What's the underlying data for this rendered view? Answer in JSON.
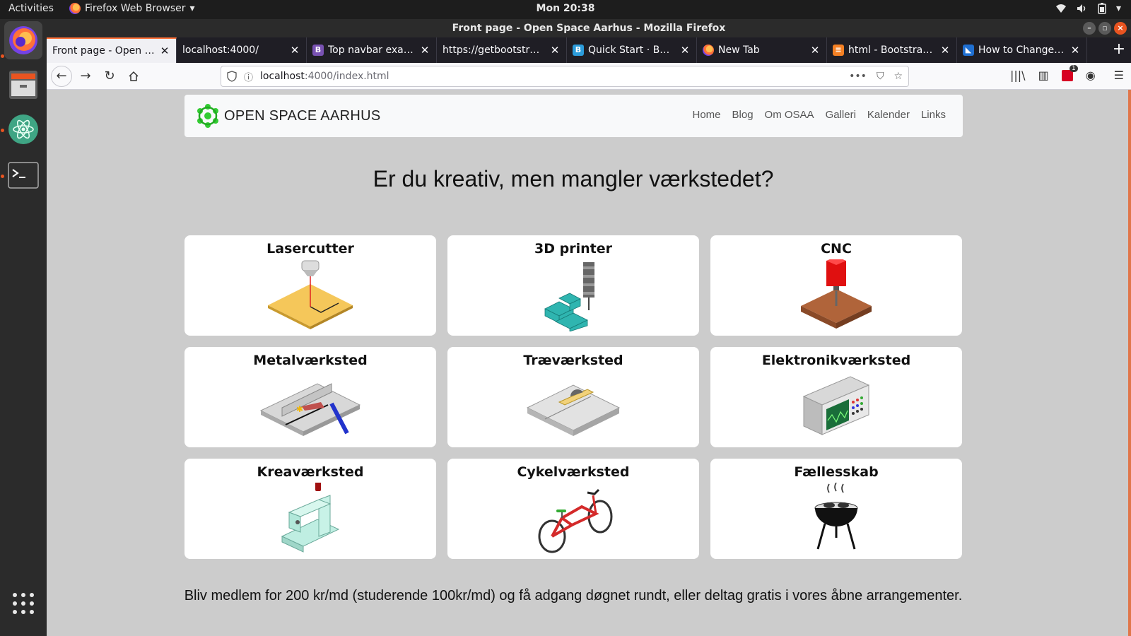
{
  "topbar": {
    "activities": "Activities",
    "app_menu": "Firefox Web Browser",
    "clock": "Mon 20:38"
  },
  "window": {
    "title": "Front page - Open Space Aarhus - Mozilla Firefox"
  },
  "tabs": [
    {
      "label": "Front page - Open Spa"
    },
    {
      "label": "localhost:4000/"
    },
    {
      "label": "Top navbar exampl"
    },
    {
      "label": "https://getbootstrap.c"
    },
    {
      "label": "Quick Start · Boots"
    },
    {
      "label": "New Tab"
    },
    {
      "label": "html - Bootstrap - F"
    },
    {
      "label": "How to Change the"
    }
  ],
  "urlbar": {
    "host": "localhost",
    "rest": ":4000/index.html"
  },
  "toolbar": {
    "badge_count": "1"
  },
  "site": {
    "brand": "OPEN SPACE AARHUS",
    "nav": [
      "Home",
      "Blog",
      "Om OSAA",
      "Galleri",
      "Kalender",
      "Links"
    ],
    "headline": "Er du kreativ, men mangler værkstedet?",
    "cards": [
      {
        "title": "Lasercutter",
        "icon": "lasercutter-icon"
      },
      {
        "title": "3D printer",
        "icon": "3d-printer-icon"
      },
      {
        "title": "CNC",
        "icon": "cnc-icon"
      },
      {
        "title": "Metalværksted",
        "icon": "metal-workshop-icon"
      },
      {
        "title": "Træværksted",
        "icon": "wood-workshop-icon"
      },
      {
        "title": "Elektronikværksted",
        "icon": "electronics-workshop-icon"
      },
      {
        "title": "Kreaværksted",
        "icon": "sewing-machine-icon"
      },
      {
        "title": "Cykelværksted",
        "icon": "bicycle-icon"
      },
      {
        "title": "Fællesskab",
        "icon": "grill-icon"
      }
    ],
    "footer": "Bliv medlem for 200 kr/md (studerende 100kr/md) og få adgang døgnet rundt, eller deltag gratis i vores åbne arrangementer."
  },
  "colors": {
    "accent": "#ff7139",
    "page_bg": "#cccccc",
    "ubuntu_orange": "#e95420"
  }
}
